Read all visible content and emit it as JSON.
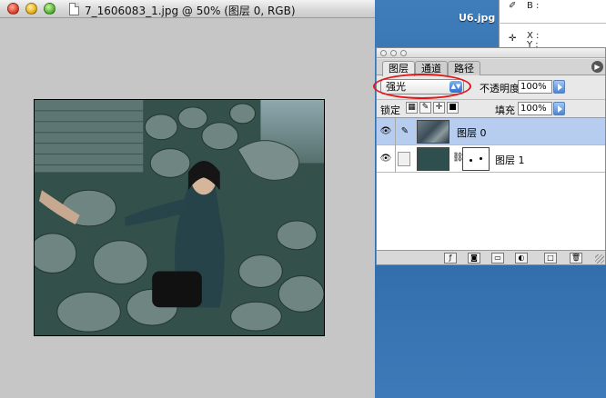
{
  "document_window": {
    "title": "7_1606083_1.jpg @ 50% (图层 0, RGB)"
  },
  "desktop": {
    "file_label": "U6.jpg"
  },
  "info_panel": {
    "b_label": "B :",
    "x_label": "X :",
    "y_label": "Y :"
  },
  "layers_palette": {
    "tabs": [
      {
        "label": "图层",
        "active": true
      },
      {
        "label": "通道",
        "active": false
      },
      {
        "label": "路径",
        "active": false
      }
    ],
    "blend_mode": "强光",
    "opacity_label": "不透明度",
    "opacity_value": "100%",
    "lock_label": "锁定",
    "fill_label": "填充",
    "fill_value": "100%",
    "layers": [
      {
        "name": "图层 0",
        "selected": true,
        "visible": true
      },
      {
        "name": "图层 1",
        "selected": false,
        "visible": true,
        "color": "#2f4f4f"
      }
    ]
  },
  "colors": {
    "desktop_blue": "#3d78b4",
    "selection_blue": "#b6cdf0",
    "highlight_ellipse": "#e01818"
  }
}
